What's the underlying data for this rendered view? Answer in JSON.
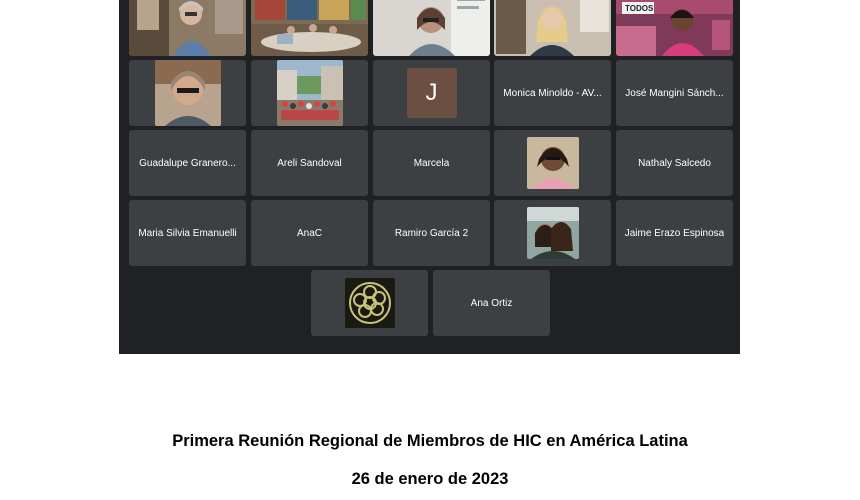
{
  "participants": [
    {
      "type": "video",
      "name": ""
    },
    {
      "type": "video",
      "name": ""
    },
    {
      "type": "video",
      "name": ""
    },
    {
      "type": "video",
      "name": "",
      "speaking": true
    },
    {
      "type": "video",
      "name": ""
    },
    {
      "type": "photo",
      "name": ""
    },
    {
      "type": "photo",
      "name": ""
    },
    {
      "type": "initial",
      "initial": "J"
    },
    {
      "type": "name",
      "name": "Monica Minoldo - AV..."
    },
    {
      "type": "name",
      "name": "José Mangini Sánch..."
    },
    {
      "type": "name",
      "name": "Guadalupe Granero..."
    },
    {
      "type": "name",
      "name": "Areli Sandoval"
    },
    {
      "type": "name",
      "name": "Marcela"
    },
    {
      "type": "photo",
      "name": ""
    },
    {
      "type": "name",
      "name": "Nathaly Salcedo"
    },
    {
      "type": "name",
      "name": "Maria Silvia Emanuelli"
    },
    {
      "type": "name",
      "name": "AnaC"
    },
    {
      "type": "name",
      "name": "Ramiro García 2"
    },
    {
      "type": "photo",
      "name": ""
    },
    {
      "type": "name",
      "name": "Jaime Erazo Espinosa"
    },
    {
      "type": "logo",
      "name": ""
    },
    {
      "type": "name",
      "name": "Ana Ortiz"
    }
  ],
  "poster_text": "TODOS",
  "caption": {
    "title": "Primera Reunión Regional de Miembros de HIC en América Latina",
    "date": "26 de enero de 2023"
  }
}
